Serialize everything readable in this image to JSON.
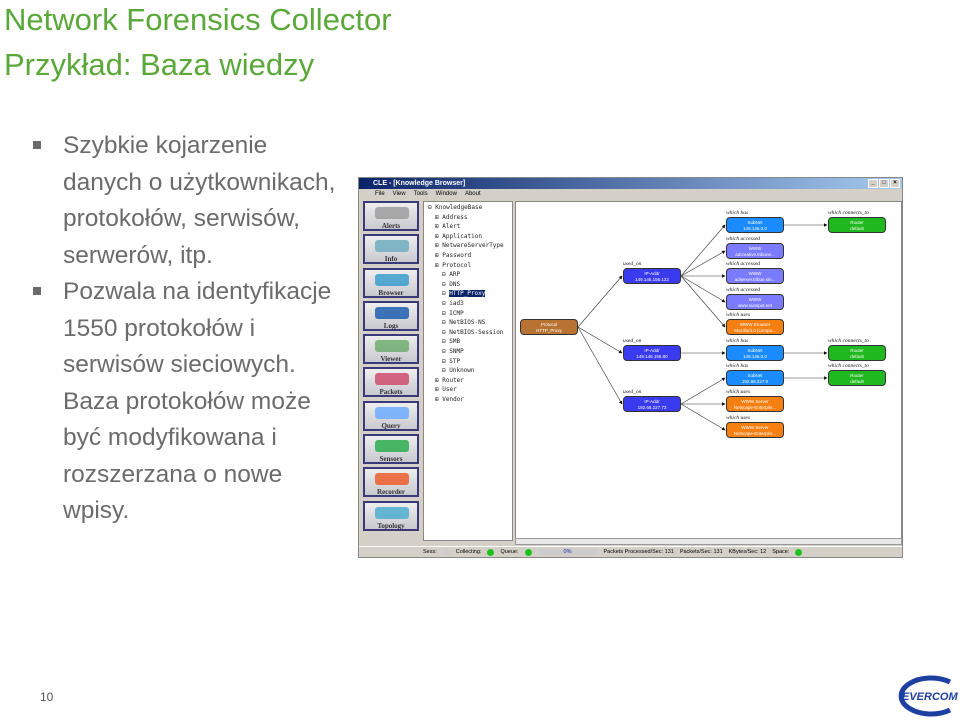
{
  "slide": {
    "title1": "Network Forensics Collector",
    "title2": "Przykład: Baza wiedzy",
    "bullets": [
      "Szybkie kojarzenie danych o użytkownikach, protokołów, serwisów, serwerów, itp.",
      "Pozwala na identyfikacje 1550 protokołów i serwisów sieciowych. Baza protokołów może być modyfikowana i rozszerzana o nowe wpisy."
    ],
    "page_number": "10",
    "logo_text": "EVERCOM",
    "colors": {
      "title": "#5aa83a",
      "text": "#6b6b6b"
    }
  },
  "window": {
    "title": "CLE - [Knowledge Browser]",
    "menu": [
      "File",
      "View",
      "Tools",
      "Window",
      "About"
    ],
    "tools": [
      {
        "label": "Alerts",
        "color": "#999"
      },
      {
        "label": "Info",
        "color": "#6ab"
      },
      {
        "label": "Browser",
        "color": "#39c"
      },
      {
        "label": "Logs",
        "color": "#15a"
      },
      {
        "label": "Viewer",
        "color": "#6a6"
      },
      {
        "label": "Packets",
        "color": "#c46"
      },
      {
        "label": "Query",
        "color": "#6af"
      },
      {
        "label": "Sensors",
        "color": "#2a4"
      },
      {
        "label": "Recorder",
        "color": "#e52"
      },
      {
        "label": "Topology",
        "color": "#4ac"
      }
    ],
    "tree": {
      "root": "KnowledgeBase",
      "items": [
        {
          "label": "Address",
          "level": 1
        },
        {
          "label": "Alert",
          "level": 1
        },
        {
          "label": "Application",
          "level": 1
        },
        {
          "label": "NetwareServerType",
          "level": 1
        },
        {
          "label": "Password",
          "level": 1
        },
        {
          "label": "Protocol",
          "level": 1
        },
        {
          "label": "ARP",
          "level": 2
        },
        {
          "label": "DNS",
          "level": 2
        },
        {
          "label": "HTTP_Proxy",
          "level": 2,
          "selected": true
        },
        {
          "label": "iad3",
          "level": 2
        },
        {
          "label": "ICMP",
          "level": 2
        },
        {
          "label": "NetBIOS-NS",
          "level": 2
        },
        {
          "label": "NetBIOS-Session",
          "level": 2
        },
        {
          "label": "SMB",
          "level": 2
        },
        {
          "label": "SNMP",
          "level": 2
        },
        {
          "label": "STP",
          "level": 2
        },
        {
          "label": "Unknown",
          "level": 2
        },
        {
          "label": "Router",
          "level": 1
        },
        {
          "label": "User",
          "level": 1
        },
        {
          "label": "Vendor",
          "level": 1
        }
      ]
    },
    "graph": {
      "nodes": [
        {
          "rel": "",
          "line1": "Protocol",
          "line2": "HTTP_Proxy",
          "color": "#b87333"
        },
        {
          "rel": "used_on",
          "line1": "IP-Addr",
          "line2": "149.146.155.122",
          "color": "#3a3aee"
        },
        {
          "rel": "used_on",
          "line1": "IP-Addr",
          "line2": "149.146.155.80",
          "color": "#3a3aee"
        },
        {
          "rel": "used_on",
          "line1": "IP-Addr",
          "line2": "192.68.227.73",
          "color": "#3a3aee"
        },
        {
          "rel": "which has",
          "line1": "SubNet",
          "line2": "149.146.0.0",
          "color": "#1a8cff"
        },
        {
          "rel": "which accessed",
          "line1": "WWW",
          "line2": "adcreative.tribune...",
          "color": "#7b7bff"
        },
        {
          "rel": "which accessed",
          "line1": "WWW",
          "line2": "adserver.tribun.sin...",
          "color": "#7b7bff"
        },
        {
          "rel": "which accessed",
          "line1": "WWW",
          "line2": "www.sunspot.net",
          "color": "#7b7bff"
        },
        {
          "rel": "which uses",
          "line1": "WWW Browser",
          "line2": "Mozilla/4.0 (compa...",
          "color": "#f57f10"
        },
        {
          "rel": "which has",
          "line1": "SubNet",
          "line2": "149.146.0.0",
          "color": "#1a8cff"
        },
        {
          "rel": "which has",
          "line1": "SubNet",
          "line2": "192.68.227.0",
          "color": "#1a8cff"
        },
        {
          "rel": "which uses",
          "line1": "WWW Server",
          "line2": "Netscape-Enterpris...",
          "color": "#f57f10"
        },
        {
          "rel": "which uses",
          "line1": "WWW Server",
          "line2": "Netscape-Enterpris...",
          "color": "#f57f10"
        },
        {
          "rel": "which connects_to",
          "line1": "Router",
          "line2": "default",
          "color": "#1fb81f"
        },
        {
          "rel": "which connects_to",
          "line1": "Router",
          "line2": "default",
          "color": "#1fb81f"
        },
        {
          "rel": "which connects_to",
          "line1": "Router",
          "line2": "default",
          "color": "#1fb81f"
        }
      ]
    },
    "status": {
      "alerts": "Alerts:",
      "sess": "Sess:",
      "collecting": "Collecting:",
      "queue": "Queue:",
      "progress": "0%",
      "packets_processed": "Packets Processed/Sec: 131",
      "packets": "Packets/Sec: 131",
      "kbytes": "KBytes/Sec: 12",
      "space": "Space:"
    }
  }
}
